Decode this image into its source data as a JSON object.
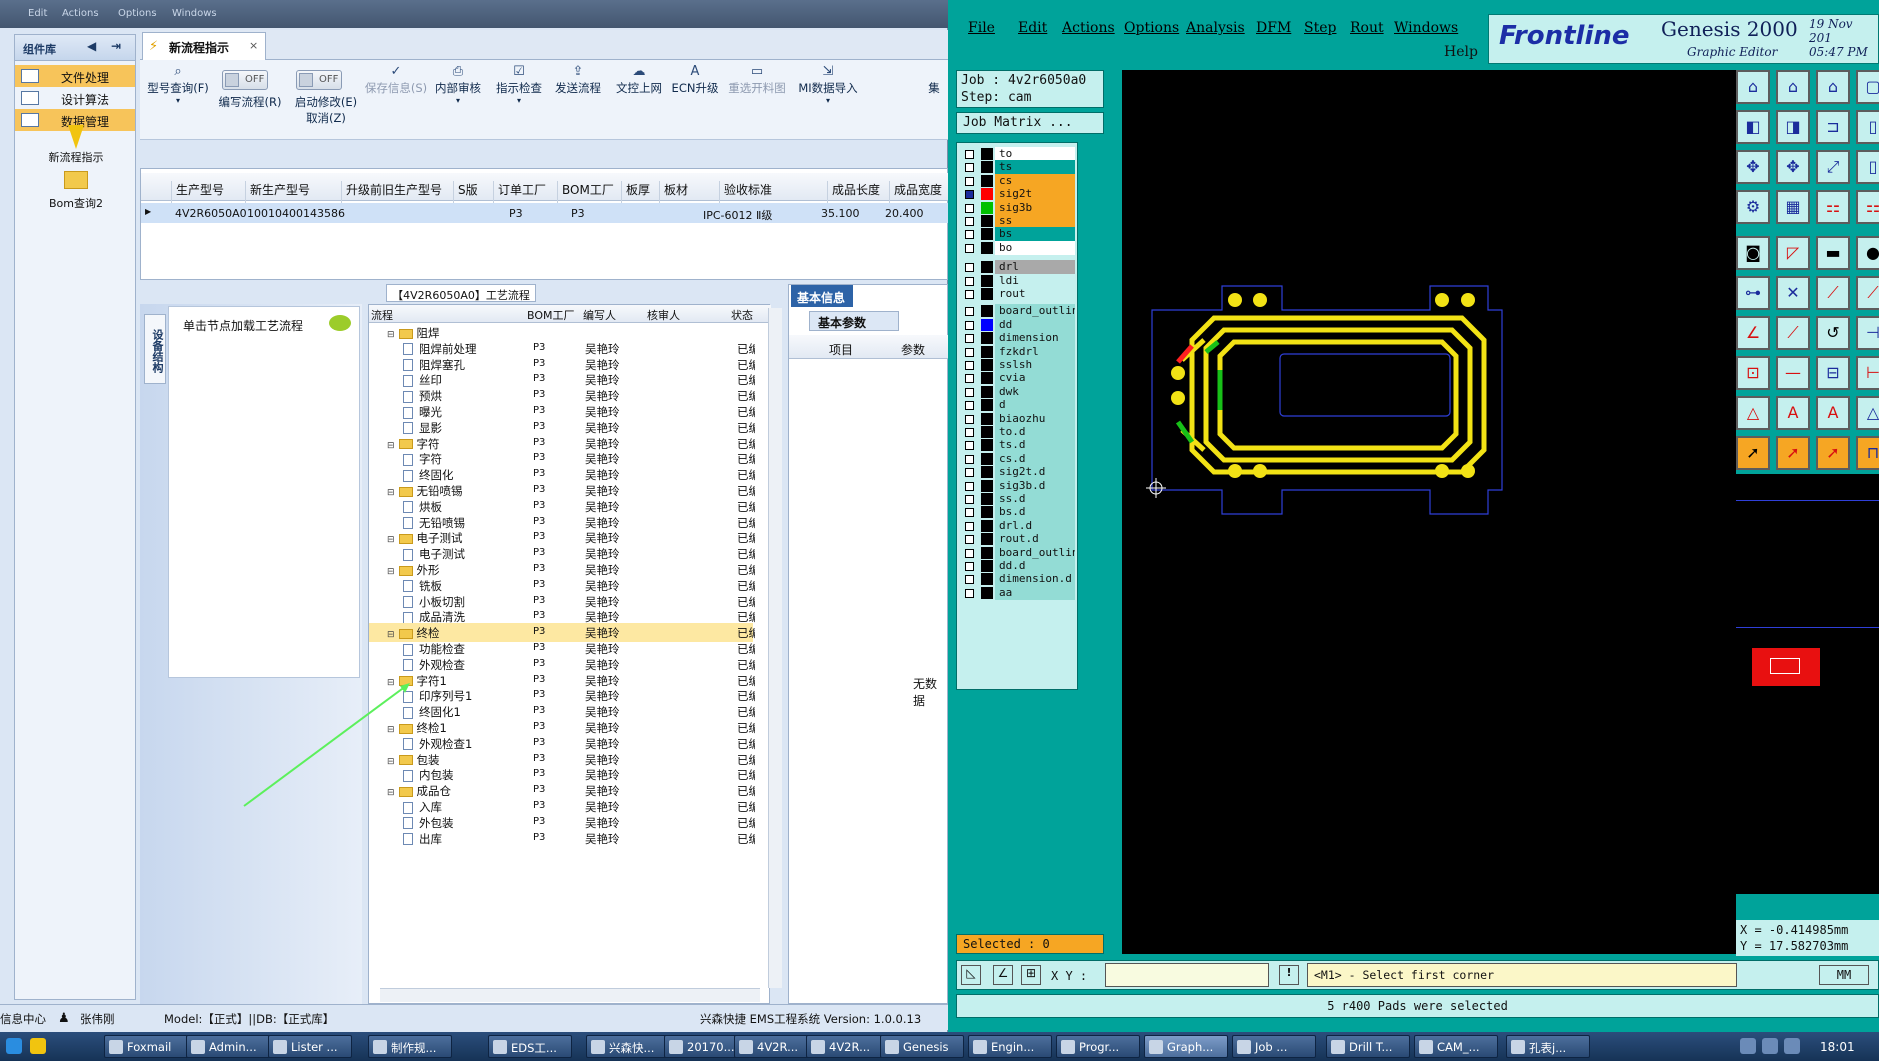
{
  "top_strip": {
    "items": [
      "Edit",
      "Actions",
      "Options",
      "Windows"
    ]
  },
  "left_panel": {
    "title": "组件库",
    "items": [
      {
        "label": "文件处理",
        "active": true
      },
      {
        "label": "设计算法",
        "active": false
      },
      {
        "label": "数据管理",
        "active": true
      }
    ],
    "subitems": [
      "新流程指示",
      "Bom查询2"
    ]
  },
  "tab": {
    "title": "新流程指示",
    "close": "×"
  },
  "toolbar": {
    "type_query": "型号查询(F)",
    "edit_flow": "编写流程(R)",
    "edit_flow_toggle": "OFF",
    "start_modify": "启动修改(E)",
    "start_modify_toggle": "OFF",
    "cancel": "取消(Z)",
    "save": "保存信息(S)",
    "internal_review": "内部审核",
    "guide_check": "指示检查",
    "send_flow": "发送流程",
    "doc_upload": "文控上网",
    "ecn_upgrade": "ECN升级",
    "reselect_chart": "重选开料图",
    "mi_import": "MI数据导入",
    "collect": "集"
  },
  "grid": {
    "columns": [
      "生产型号",
      "新生产型号",
      "升级前旧生产型号",
      "S版",
      "订单工厂",
      "BOM工厂",
      "板厚",
      "板材",
      "验收标准",
      "成品长度",
      "成品宽度"
    ],
    "row": [
      "4V2R6050A0",
      "10010400143586",
      "",
      "",
      "P3",
      "P3",
      "",
      "",
      "IPC-6012 Ⅱ级",
      "35.100",
      "20.400"
    ]
  },
  "process_title": "【4V2R6050A0】工艺流程",
  "side_tab": "设备结构",
  "hint": "单击节点加载工艺流程",
  "tree": {
    "columns": [
      "流程",
      "BOM工厂",
      "编写人",
      "核审人",
      "状态"
    ],
    "rows": [
      {
        "name": "阻焊",
        "type": "folder",
        "level": 0,
        "bom": "",
        "writer": "",
        "status": "",
        "partial": true
      },
      {
        "name": "阻焊前处理",
        "type": "doc",
        "level": 1,
        "bom": "P3",
        "writer": "吴艳玲",
        "status": "已编写"
      },
      {
        "name": "阻焊塞孔",
        "type": "doc",
        "level": 1,
        "bom": "P3",
        "writer": "吴艳玲",
        "status": "已编写"
      },
      {
        "name": "丝印",
        "type": "doc",
        "level": 1,
        "bom": "P3",
        "writer": "吴艳玲",
        "status": "已编写"
      },
      {
        "name": "预烘",
        "type": "doc",
        "level": 1,
        "bom": "P3",
        "writer": "吴艳玲",
        "status": "已编写"
      },
      {
        "name": "曝光",
        "type": "doc",
        "level": 1,
        "bom": "P3",
        "writer": "吴艳玲",
        "status": "已编写"
      },
      {
        "name": "显影",
        "type": "doc",
        "level": 1,
        "bom": "P3",
        "writer": "吴艳玲",
        "status": "已编写"
      },
      {
        "name": "字符",
        "type": "folder",
        "level": 0,
        "bom": "P3",
        "writer": "吴艳玲",
        "status": "已编写"
      },
      {
        "name": "字符",
        "type": "doc",
        "level": 1,
        "bom": "P3",
        "writer": "吴艳玲",
        "status": "已编写"
      },
      {
        "name": "终固化",
        "type": "doc",
        "level": 1,
        "bom": "P3",
        "writer": "吴艳玲",
        "status": "已编写"
      },
      {
        "name": "无铅喷锡",
        "type": "folder",
        "level": 0,
        "bom": "P3",
        "writer": "吴艳玲",
        "status": "已编写"
      },
      {
        "name": "烘板",
        "type": "doc",
        "level": 1,
        "bom": "P3",
        "writer": "吴艳玲",
        "status": "已编写"
      },
      {
        "name": "无铅喷锡",
        "type": "doc",
        "level": 1,
        "bom": "P3",
        "writer": "吴艳玲",
        "status": "已编写"
      },
      {
        "name": "电子测试",
        "type": "folder",
        "level": 0,
        "bom": "P3",
        "writer": "吴艳玲",
        "status": "已编写"
      },
      {
        "name": "电子测试",
        "type": "doc",
        "level": 1,
        "bom": "P3",
        "writer": "吴艳玲",
        "status": "已编写"
      },
      {
        "name": "外形",
        "type": "folder",
        "level": 0,
        "bom": "P3",
        "writer": "吴艳玲",
        "status": "已编写"
      },
      {
        "name": "铣板",
        "type": "doc",
        "level": 1,
        "bom": "P3",
        "writer": "吴艳玲",
        "status": "已编写"
      },
      {
        "name": "小板切割",
        "type": "doc",
        "level": 1,
        "bom": "P3",
        "writer": "吴艳玲",
        "status": "已编写"
      },
      {
        "name": "成品清洗",
        "type": "doc",
        "level": 1,
        "bom": "P3",
        "writer": "吴艳玲",
        "status": "已编写"
      },
      {
        "name": "终检",
        "type": "folder",
        "level": 0,
        "bom": "P3",
        "writer": "吴艳玲",
        "status": "已编写",
        "selected": true
      },
      {
        "name": "功能检查",
        "type": "doc",
        "level": 1,
        "bom": "P3",
        "writer": "吴艳玲",
        "status": "已编写"
      },
      {
        "name": "外观检查",
        "type": "doc",
        "level": 1,
        "bom": "P3",
        "writer": "吴艳玲",
        "status": "已编写"
      },
      {
        "name": "字符1",
        "type": "folder",
        "level": 0,
        "bom": "P3",
        "writer": "吴艳玲",
        "status": "已编写"
      },
      {
        "name": "印序列号1",
        "type": "doc",
        "level": 1,
        "bom": "P3",
        "writer": "吴艳玲",
        "status": "已编写"
      },
      {
        "name": "终固化1",
        "type": "doc",
        "level": 1,
        "bom": "P3",
        "writer": "吴艳玲",
        "status": "已编写"
      },
      {
        "name": "终检1",
        "type": "folder",
        "level": 0,
        "bom": "P3",
        "writer": "吴艳玲",
        "status": "已编写"
      },
      {
        "name": "外观检查1",
        "type": "doc",
        "level": 1,
        "bom": "P3",
        "writer": "吴艳玲",
        "status": "已编写"
      },
      {
        "name": "包装",
        "type": "folder",
        "level": 0,
        "bom": "P3",
        "writer": "吴艳玲",
        "status": "已编写"
      },
      {
        "name": "内包装",
        "type": "doc",
        "level": 1,
        "bom": "P3",
        "writer": "吴艳玲",
        "status": "已编写"
      },
      {
        "name": "成品仓",
        "type": "folder",
        "level": 0,
        "bom": "P3",
        "writer": "吴艳玲",
        "status": "已编写"
      },
      {
        "name": "入库",
        "type": "doc",
        "level": 1,
        "bom": "P3",
        "writer": "吴艳玲",
        "status": "已编写"
      },
      {
        "name": "外包装",
        "type": "doc",
        "level": 1,
        "bom": "P3",
        "writer": "吴艳玲",
        "status": "已编写"
      },
      {
        "name": "出库",
        "type": "doc",
        "level": 1,
        "bom": "P3",
        "writer": "吴艳玲",
        "status": "已编写"
      }
    ]
  },
  "info_panel": {
    "tab": "基本信息",
    "subtab": "基本参数",
    "col_item": "项目",
    "col_param": "参数",
    "empty": "无数据"
  },
  "status_bar": {
    "info_center": "信息中心",
    "user": "张伟刚",
    "model": "Model:【正式】||DB:【正式库】",
    "company": "兴森快捷 EMS工程系统 Version: 1.0.0.13"
  },
  "genesis": {
    "menu": [
      "File",
      "Edit",
      "Actions",
      "Options",
      "Analysis",
      "DFM",
      "Step",
      "Rout",
      "Windows"
    ],
    "help": "Help",
    "logo_frontline": "Frontline",
    "logo_genesis": "Genesis 2000",
    "logo_sub": "Graphic Editor",
    "date": "19 Nov 201",
    "time": "05:47 PM",
    "job": "Job : 4v2r6050a0",
    "step": "Step: cam",
    "job_matrix": "Job Matrix ...",
    "layers": [
      {
        "name": "to",
        "bg": "#ffffff",
        "swatch": "#000000",
        "checked": false
      },
      {
        "name": "ts",
        "bg": "#00a39a",
        "swatch": "#000000",
        "checked": false
      },
      {
        "name": "cs",
        "bg": "#f6a623",
        "swatch": "#000000",
        "checked": false
      },
      {
        "name": "sig2t",
        "bg": "#f6a623",
        "swatch": "#ff0000",
        "checked": true
      },
      {
        "name": "sig3b",
        "bg": "#f6a623",
        "swatch": "#00c000",
        "checked": false
      },
      {
        "name": "ss",
        "bg": "#f6a623",
        "swatch": "#000000",
        "checked": false
      },
      {
        "name": "bs",
        "bg": "#00a39a",
        "swatch": "#000000",
        "checked": false
      },
      {
        "name": "bo",
        "bg": "#ffffff",
        "swatch": "#000000",
        "checked": false
      },
      {
        "name": "drl",
        "bg": "#a9a9a9",
        "swatch": "#000000",
        "checked": false
      },
      {
        "name": "ldi",
        "bg": "#c5f0ee",
        "swatch": "#000000",
        "checked": false
      },
      {
        "name": "rout",
        "bg": "#c5f0ee",
        "swatch": "#000000",
        "checked": false
      },
      {
        "name": "board_outline",
        "bg": "#93dcd5",
        "swatch": "#000000",
        "checked": false
      },
      {
        "name": "dd",
        "bg": "#93dcd5",
        "swatch": "#0000ff",
        "checked": false
      },
      {
        "name": "dimension",
        "bg": "#93dcd5",
        "swatch": "#000000",
        "checked": false
      },
      {
        "name": "fzkdrl",
        "bg": "#93dcd5",
        "swatch": "#000000",
        "checked": false
      },
      {
        "name": "sslsh",
        "bg": "#93dcd5",
        "swatch": "#000000",
        "checked": false
      },
      {
        "name": "cvia",
        "bg": "#93dcd5",
        "swatch": "#000000",
        "checked": false
      },
      {
        "name": "dwk",
        "bg": "#93dcd5",
        "swatch": "#000000",
        "checked": false
      },
      {
        "name": "d",
        "bg": "#93dcd5",
        "swatch": "#000000",
        "checked": false
      },
      {
        "name": "biaozhu",
        "bg": "#93dcd5",
        "swatch": "#000000",
        "checked": false
      },
      {
        "name": "to.d",
        "bg": "#93dcd5",
        "swatch": "#000000",
        "checked": false
      },
      {
        "name": "ts.d",
        "bg": "#93dcd5",
        "swatch": "#000000",
        "checked": false
      },
      {
        "name": "cs.d",
        "bg": "#93dcd5",
        "swatch": "#000000",
        "checked": false
      },
      {
        "name": "sig2t.d",
        "bg": "#93dcd5",
        "swatch": "#000000",
        "checked": false
      },
      {
        "name": "sig3b.d",
        "bg": "#93dcd5",
        "swatch": "#000000",
        "checked": false
      },
      {
        "name": "ss.d",
        "bg": "#93dcd5",
        "swatch": "#000000",
        "checked": false
      },
      {
        "name": "bs.d",
        "bg": "#93dcd5",
        "swatch": "#000000",
        "checked": false
      },
      {
        "name": "drl.d",
        "bg": "#93dcd5",
        "swatch": "#000000",
        "checked": false
      },
      {
        "name": "rout.d",
        "bg": "#93dcd5",
        "swatch": "#000000",
        "checked": false
      },
      {
        "name": "board_outline",
        "bg": "#93dcd5",
        "swatch": "#000000",
        "checked": false
      },
      {
        "name": "dd.d",
        "bg": "#93dcd5",
        "swatch": "#000000",
        "checked": false
      },
      {
        "name": "dimension.d",
        "bg": "#93dcd5",
        "swatch": "#000000",
        "checked": false
      },
      {
        "name": "aa",
        "bg": "#93dcd5",
        "swatch": "#000000",
        "checked": false
      }
    ],
    "selected": "Selected : 0",
    "xy_label": "X Y :",
    "command_msg": "<M1> - Select first corner",
    "units": "MM",
    "coord_x": "X = -0.414985mm",
    "coord_y": "Y = 17.582703mm",
    "status": "5 r400 Pads were selected"
  },
  "taskbar": {
    "items": [
      "Foxmail",
      "Admin...",
      "Lister ...",
      "制作规...",
      "EDS工...",
      "兴森快...",
      "20170...",
      "4V2R...",
      "4V2R...",
      "Genesis",
      "Engin...",
      "Progr...",
      "Graph...",
      "Job ...",
      "Drill T...",
      "CAM_...",
      "孔表j..."
    ],
    "clock": "18:01"
  }
}
